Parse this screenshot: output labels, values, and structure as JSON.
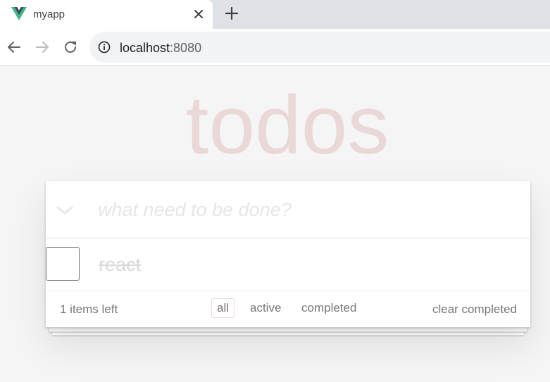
{
  "browser": {
    "tab_title": "myapp",
    "url_host": "localhost",
    "url_port": ":8080"
  },
  "app": {
    "title": "todos",
    "new_todo_placeholder": "what need to be done?",
    "todos": [
      {
        "label": "react",
        "completed": true
      }
    ],
    "footer": {
      "items_left": "1 items left",
      "filters": [
        "all",
        "active",
        "completed"
      ],
      "selected_filter": "all",
      "clear_completed": "clear completed"
    }
  },
  "colors": {
    "title": "#af2f2f",
    "vue_green": "#41b883",
    "vue_dark": "#34495e"
  },
  "icons": {
    "favicon": "vue-logo-icon",
    "close": "close-icon",
    "new_tab": "plus-icon",
    "back": "arrow-left-icon",
    "forward": "arrow-right-icon",
    "reload": "reload-icon",
    "site_info": "info-icon",
    "toggle_all": "chevron-down-icon"
  }
}
